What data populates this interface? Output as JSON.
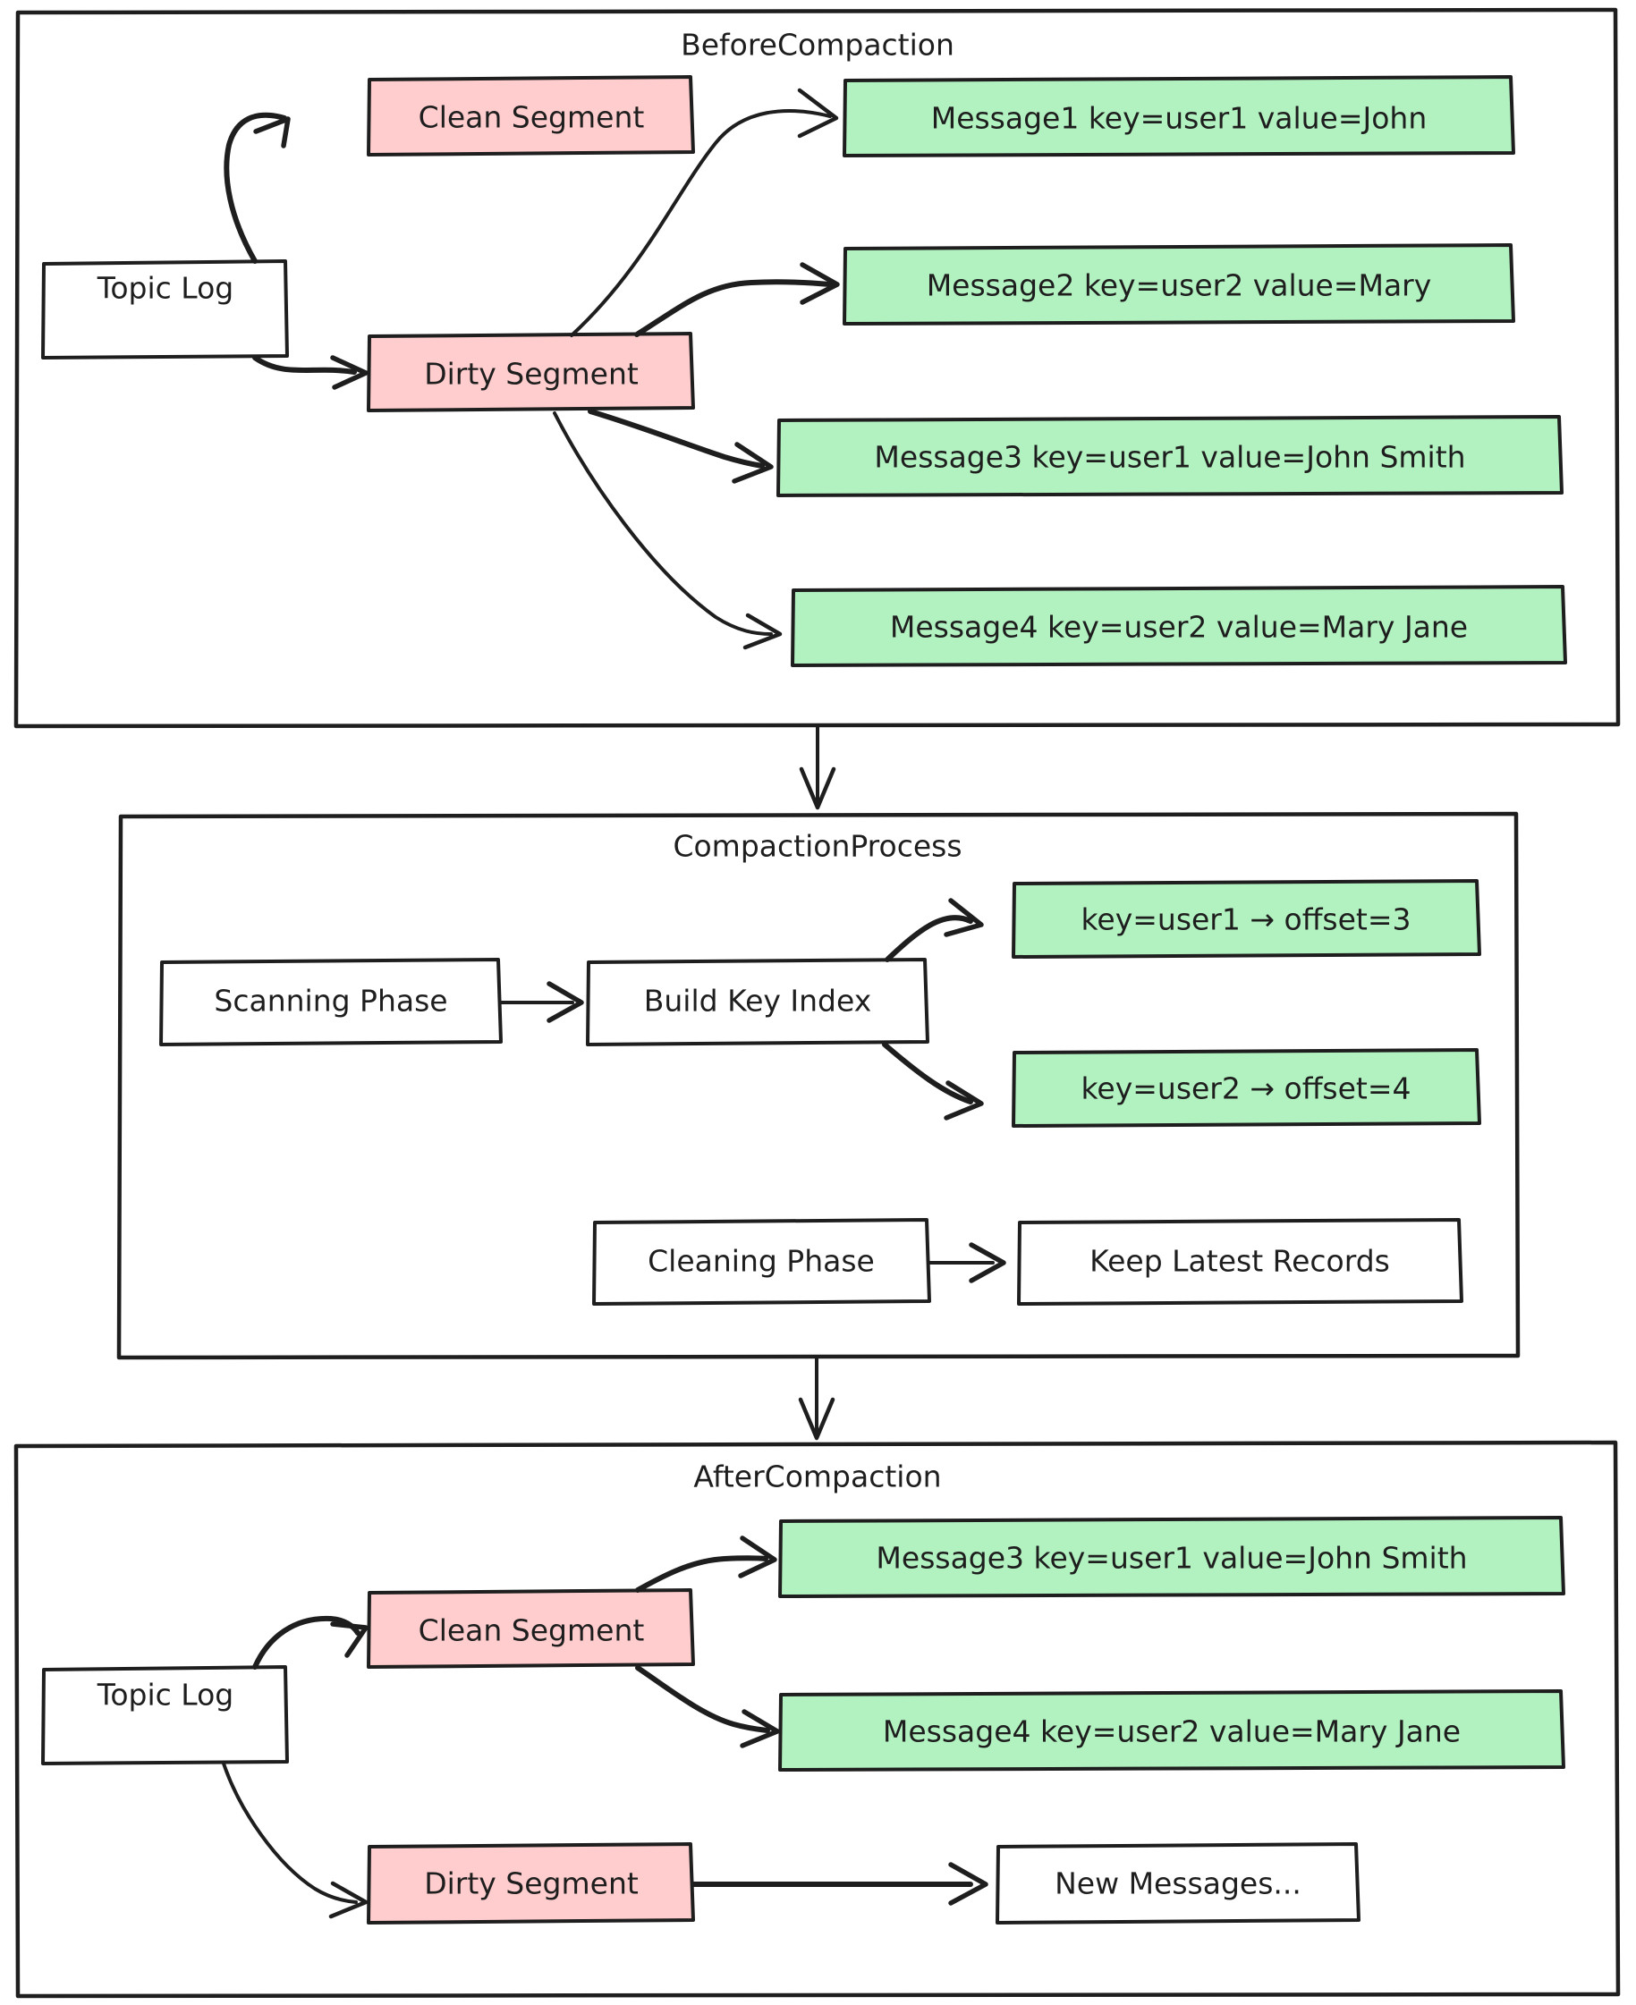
{
  "diagram": {
    "groups": [
      {
        "id": "before",
        "title": "BeforeCompaction",
        "nodes": {
          "topic_log": "Topic Log",
          "clean_segment": "Clean Segment",
          "dirty_segment": "Dirty Segment",
          "message1": "Message1 key=user1 value=John",
          "message2": "Message2 key=user2 value=Mary",
          "message3": "Message3 key=user1 value=John Smith",
          "message4": "Message4 key=user2 value=Mary Jane"
        }
      },
      {
        "id": "process",
        "title": "CompactionProcess",
        "nodes": {
          "scanning_phase": "Scanning Phase",
          "build_key_index": "Build Key Index",
          "index_user1": "key=user1 → offset=3",
          "index_user2": "key=user2 → offset=4",
          "cleaning_phase": "Cleaning Phase",
          "keep_latest": "Keep Latest Records"
        }
      },
      {
        "id": "after",
        "title": "AfterCompaction",
        "nodes": {
          "topic_log": "Topic Log",
          "clean_segment": "Clean Segment",
          "dirty_segment": "Dirty Segment",
          "message3": "Message3 key=user1 value=John Smith",
          "message4": "Message4 key=user2 value=Mary Jane",
          "new_messages": "New Messages..."
        }
      }
    ],
    "colors": {
      "stroke": "#1e1e1e",
      "pink_fill": "#ffcdcd",
      "green_fill": "#b2f1c0",
      "white_fill": "#ffffff",
      "background": "#ffffff"
    }
  }
}
